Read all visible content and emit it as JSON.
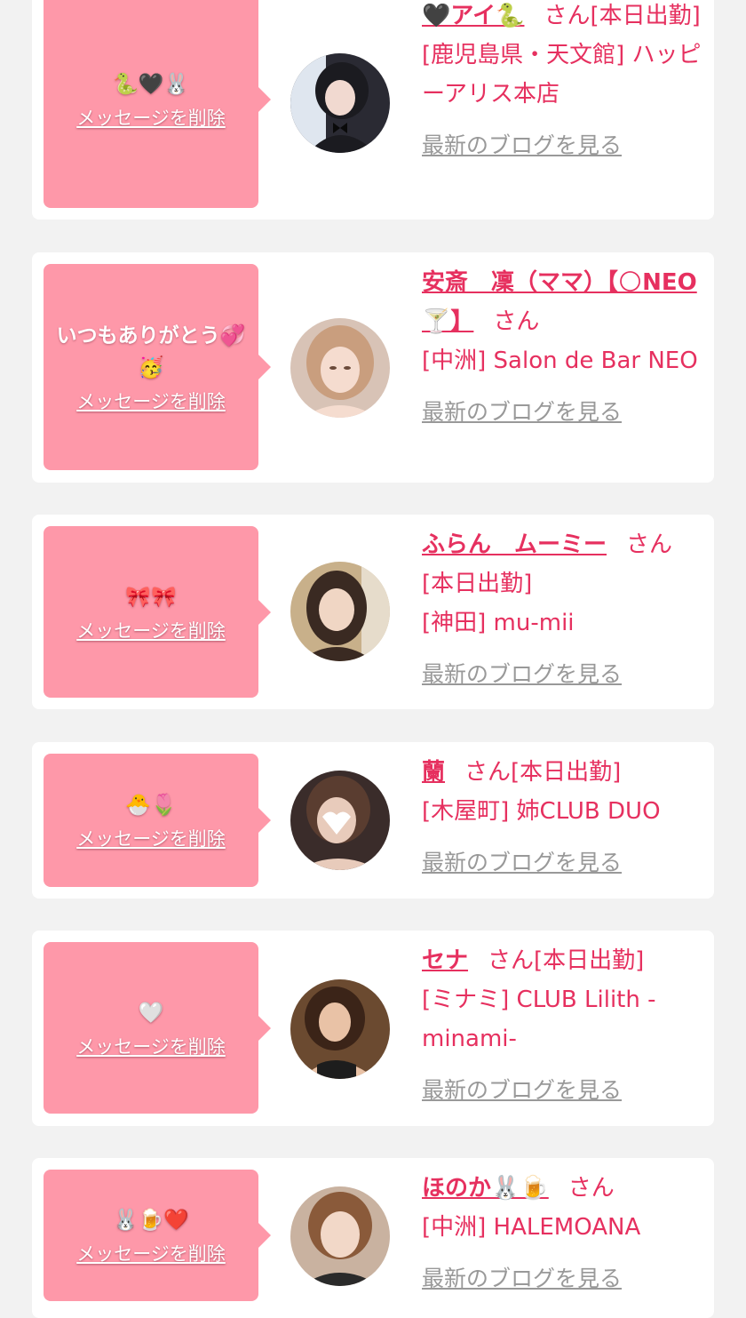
{
  "delete_label": "メッセージを削除",
  "blog_label": "最新のブログを見る",
  "san_label": "さん",
  "colors": {
    "background": "#f2f2f2",
    "card": "#ffffff",
    "bubble": "#fe98a9",
    "accent": "#e6305f",
    "muted": "#999999"
  },
  "items": [
    {
      "message": "🐍🖤🐰",
      "name": "🖤アイ🐍",
      "status": "[本日出勤]",
      "location": "[鹿児島県・天文館] ハッピーアリス本店",
      "avatar": {
        "bg": "#2a2a33",
        "skin": "#f1d9d0",
        "hair": "#1b1b20",
        "accent": "#5a6a8a"
      }
    },
    {
      "message": "いつもありがとう💞🥳",
      "name": "安斎　凜（ママ）【🌕NEO🍸】",
      "status": "",
      "location": "[中洲] Salon de Bar NEO",
      "avatar": {
        "bg": "#d8c3b6",
        "skin": "#f5dccf",
        "hair": "#c99e7e",
        "accent": "#a07a68"
      }
    },
    {
      "message": "🎀🎀",
      "name": "ふらん　ムーミー",
      "status": "[本日出勤]",
      "location": "[神田] mu-mii",
      "avatar": {
        "bg": "#c8b08a",
        "skin": "#f0d6c4",
        "hair": "#3a2a22",
        "accent": "#e6dccb"
      }
    },
    {
      "message": "🐣🌷",
      "name": "蘭",
      "status": "[本日出勤]",
      "location": "[木屋町] 姉CLUB DUO",
      "avatar": {
        "bg": "#3a2c2a",
        "skin": "#e8cbbb",
        "hair": "#5a3d30",
        "accent": "#ffffff"
      }
    },
    {
      "message": "🤍",
      "name": "セナ",
      "status": "[本日出勤]",
      "location": "[ミナミ] CLUB Lilith -minami-",
      "avatar": {
        "bg": "#6b4a30",
        "skin": "#e9c2a6",
        "hair": "#3b2418",
        "accent": "#1d1d1d"
      }
    },
    {
      "message": "🐰🍺❤️",
      "name": "ほのか🐰🍺",
      "status": "",
      "location": "[中洲] HALEMOANA",
      "avatar": {
        "bg": "#c9b2a0",
        "skin": "#f2d8c8",
        "hair": "#8a5a3a",
        "accent": "#2a2a2a"
      }
    }
  ]
}
